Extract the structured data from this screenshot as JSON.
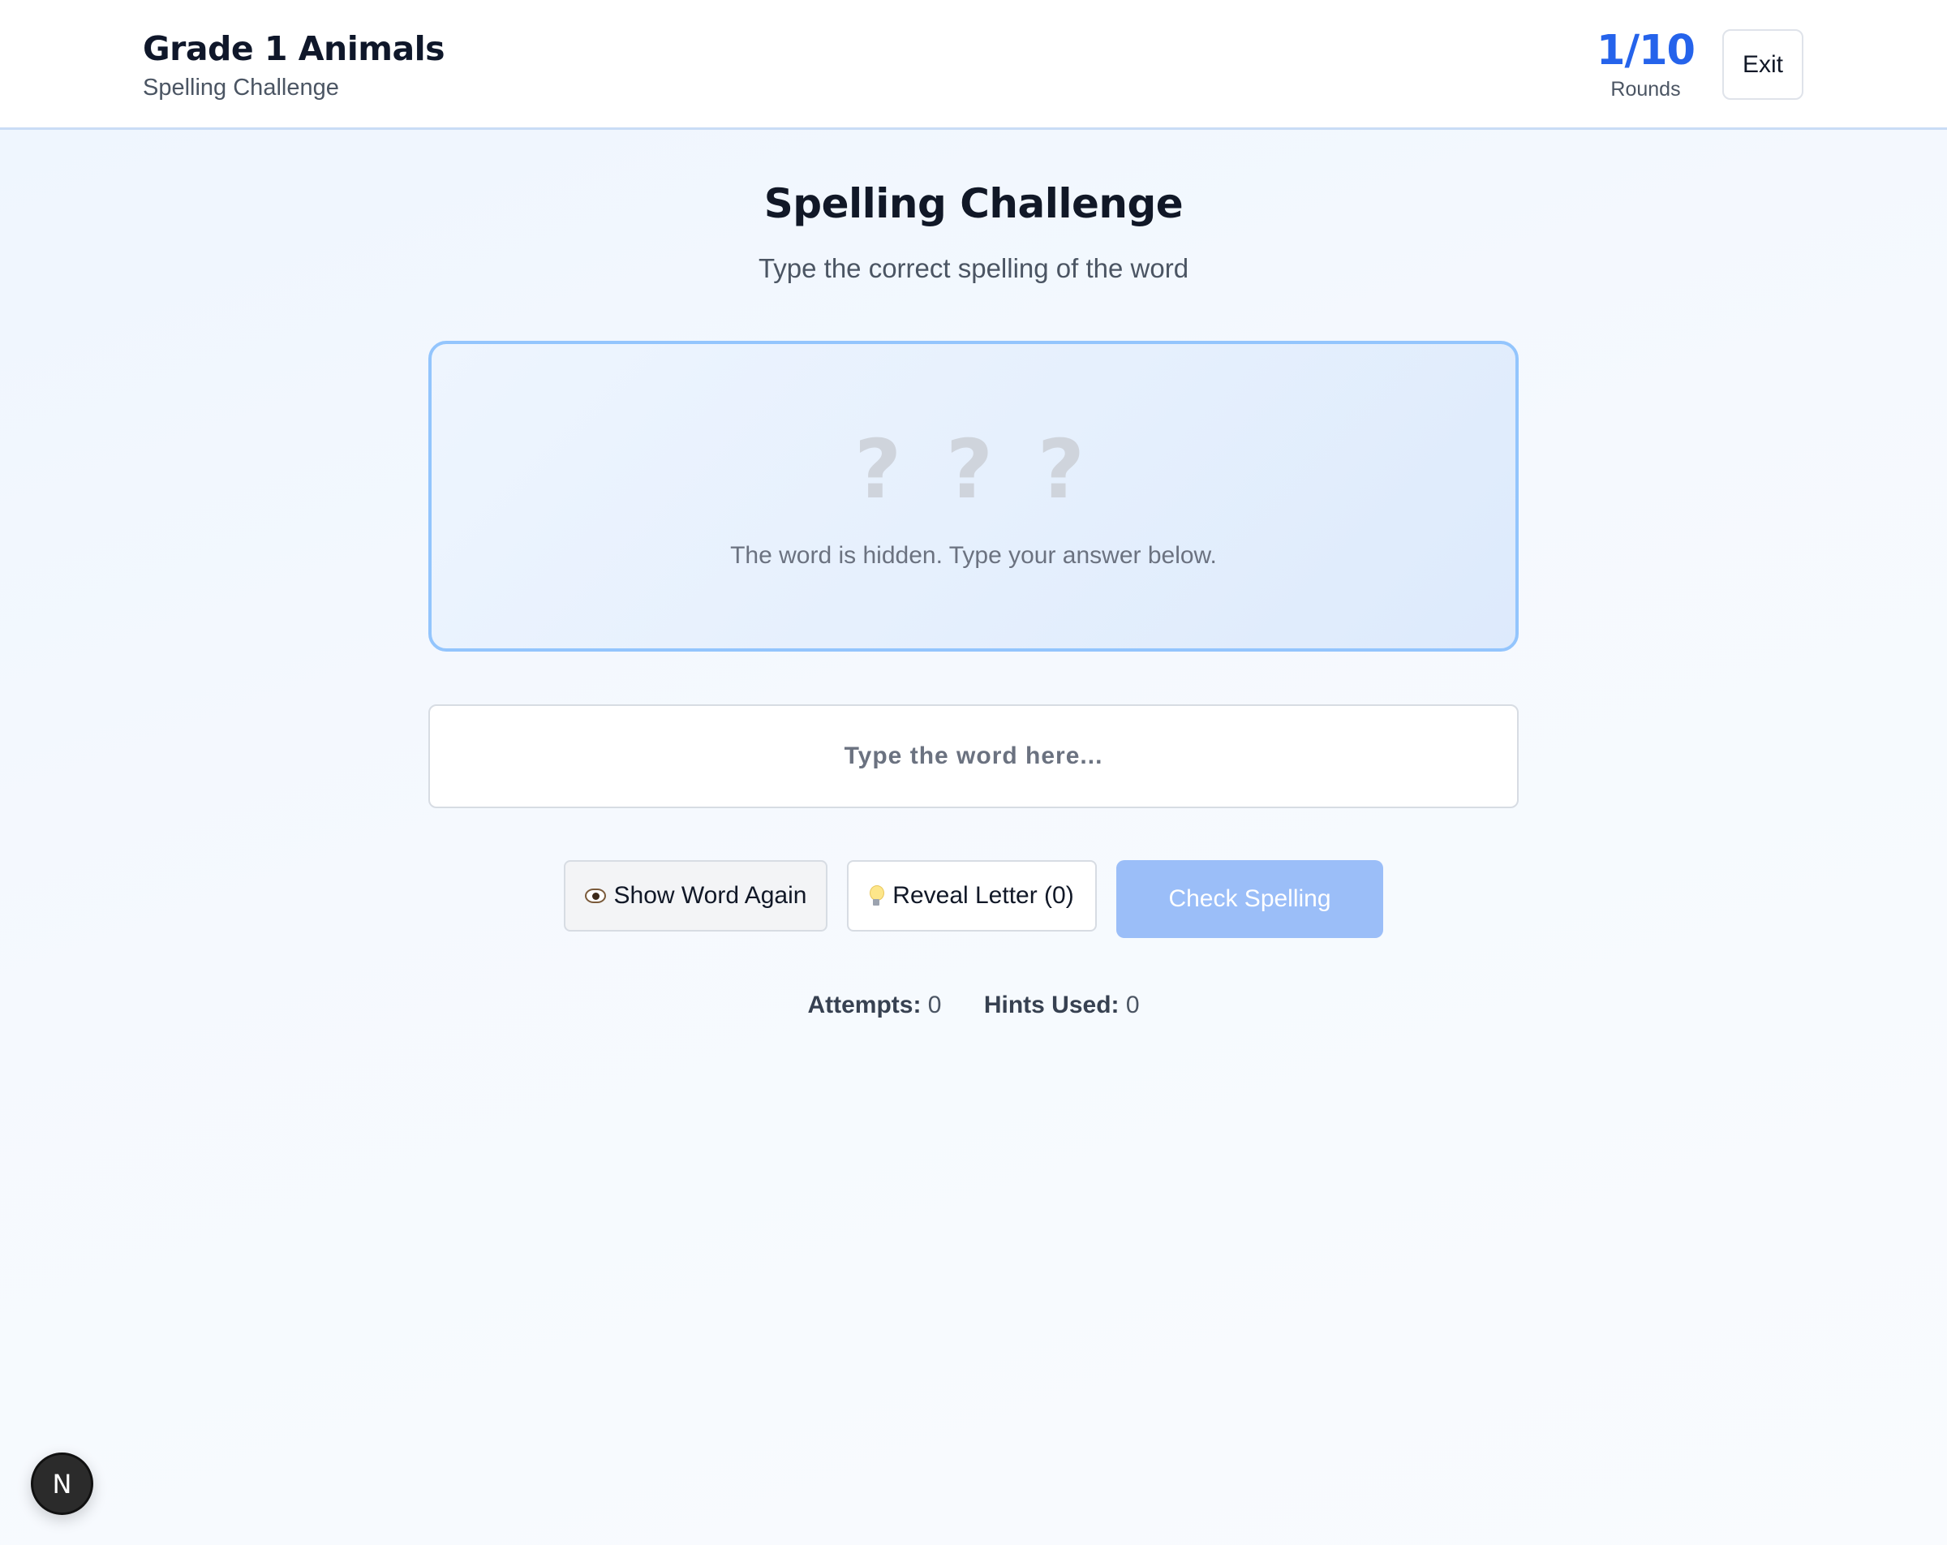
{
  "header": {
    "title": "Grade 1 Animals",
    "subtitle": "Spelling Challenge",
    "rounds_count": "1/10",
    "rounds_label": "Rounds",
    "exit_label": "Exit"
  },
  "main": {
    "title": "Spelling Challenge",
    "subtitle": "Type the correct spelling of the word",
    "masked_word": "? ? ?",
    "hidden_note": "The word is hidden. Type your answer below.",
    "input_placeholder": "Type the word here...",
    "input_value": ""
  },
  "actions": {
    "show_word_label": "Show Word Again",
    "show_word_icon": "eye-icon",
    "reveal_letter_label": "Reveal Letter (0)",
    "reveal_letter_icon": "lightbulb-icon",
    "check_label": "Check Spelling"
  },
  "stats": {
    "attempts_label": "Attempts:",
    "attempts_value": "0",
    "hints_label": "Hints Used:",
    "hints_value": "0"
  },
  "dev_badge": {
    "label": "N"
  },
  "colors": {
    "accent": "#2563eb",
    "card_border": "#93c5fd",
    "check_button": "#9bbef8"
  }
}
